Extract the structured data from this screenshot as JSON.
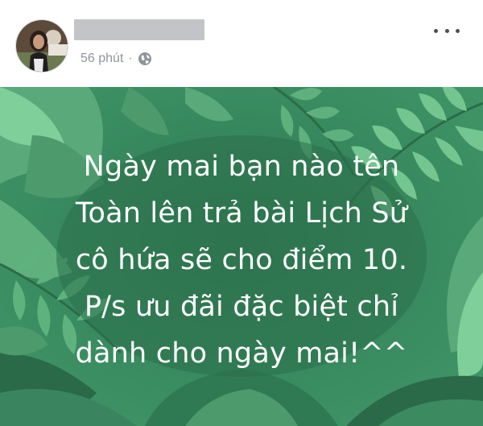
{
  "post": {
    "time_label": "56 phút",
    "separator": "·",
    "audience_icon": "globe-icon",
    "more_icon": "more-options-icon",
    "avatar_icon": "profile-avatar"
  },
  "image_text": {
    "lines": [
      "Ngày mai bạn nào tên",
      "Toàn lên trả bài Lịch Sử",
      "cô hứa sẽ cho điểm 10.",
      "P/s ưu đãi đặc biệt chỉ",
      "dành cho ngày mai!^^"
    ]
  },
  "colors": {
    "background_green": "#3d8a62",
    "leaf_light": "#6fc08a",
    "leaf_dark": "#2a6a48",
    "text_white": "#ffffff",
    "meta_gray": "#90949c"
  }
}
